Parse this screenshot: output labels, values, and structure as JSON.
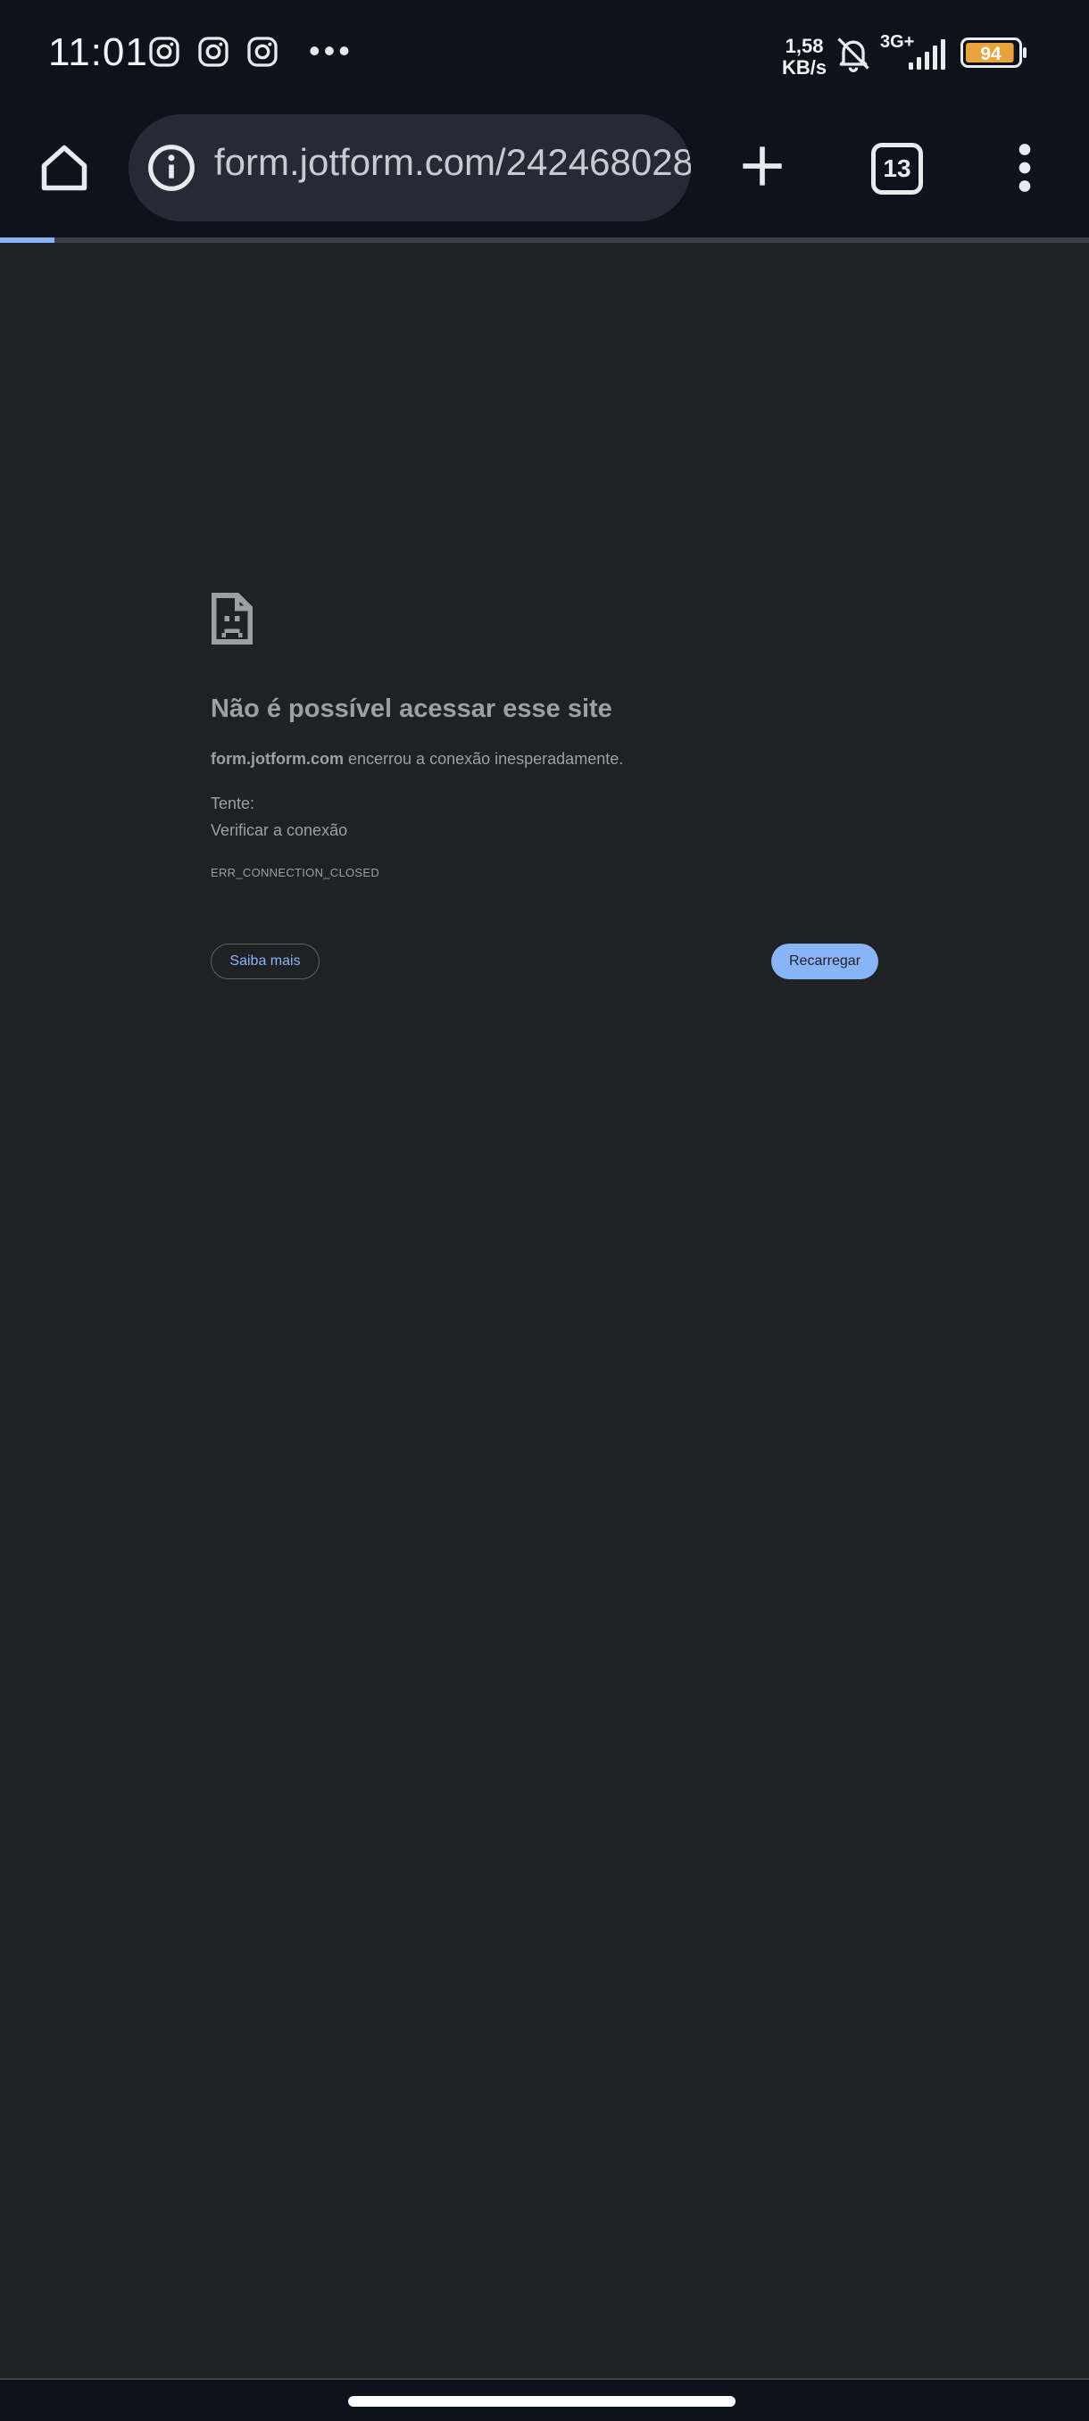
{
  "status_bar": {
    "time": "11:01",
    "notification_icons": [
      "instagram-icon",
      "instagram-icon",
      "instagram-icon"
    ],
    "more_dots": "•••",
    "net_speed_value": "1,58",
    "net_speed_unit": "KB/s",
    "network_type": "3G+",
    "battery_level": "94",
    "battery_color": "#e8a33c"
  },
  "browser_toolbar": {
    "url": "form.jotform.com/242468028",
    "tab_count": "13",
    "load_progress_percent": 5
  },
  "error_page": {
    "title": "Não é possível acessar esse site",
    "host": "form.jotform.com",
    "description_suffix": " encerrou a conexão inesperadamente.",
    "try_label": "Tente:",
    "suggestion": "Verificar a conexão",
    "error_code": "ERR_CONNECTION_CLOSED",
    "learn_more_label": "Saiba mais",
    "reload_label": "Recarregar"
  },
  "colors": {
    "background": "#202124",
    "bars": "#0e121b",
    "accent": "#8ab4f8",
    "text_muted": "#9aa0a6"
  }
}
